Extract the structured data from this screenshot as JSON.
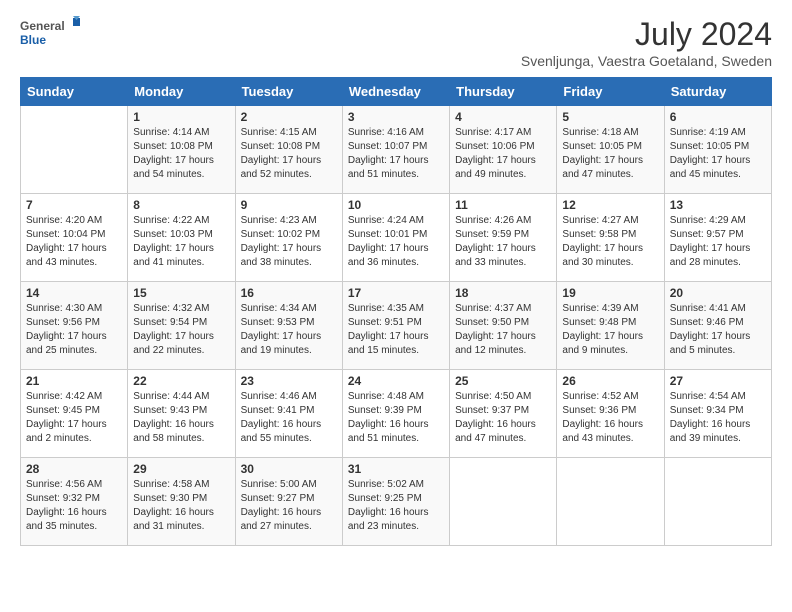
{
  "header": {
    "logo_general": "General",
    "logo_blue": "Blue",
    "title": "July 2024",
    "location": "Svenljunga, Vaestra Goetaland, Sweden"
  },
  "calendar": {
    "days_of_week": [
      "Sunday",
      "Monday",
      "Tuesday",
      "Wednesday",
      "Thursday",
      "Friday",
      "Saturday"
    ],
    "weeks": [
      [
        {
          "day": "",
          "info": ""
        },
        {
          "day": "1",
          "info": "Sunrise: 4:14 AM\nSunset: 10:08 PM\nDaylight: 17 hours\nand 54 minutes."
        },
        {
          "day": "2",
          "info": "Sunrise: 4:15 AM\nSunset: 10:08 PM\nDaylight: 17 hours\nand 52 minutes."
        },
        {
          "day": "3",
          "info": "Sunrise: 4:16 AM\nSunset: 10:07 PM\nDaylight: 17 hours\nand 51 minutes."
        },
        {
          "day": "4",
          "info": "Sunrise: 4:17 AM\nSunset: 10:06 PM\nDaylight: 17 hours\nand 49 minutes."
        },
        {
          "day": "5",
          "info": "Sunrise: 4:18 AM\nSunset: 10:05 PM\nDaylight: 17 hours\nand 47 minutes."
        },
        {
          "day": "6",
          "info": "Sunrise: 4:19 AM\nSunset: 10:05 PM\nDaylight: 17 hours\nand 45 minutes."
        }
      ],
      [
        {
          "day": "7",
          "info": "Sunrise: 4:20 AM\nSunset: 10:04 PM\nDaylight: 17 hours\nand 43 minutes."
        },
        {
          "day": "8",
          "info": "Sunrise: 4:22 AM\nSunset: 10:03 PM\nDaylight: 17 hours\nand 41 minutes."
        },
        {
          "day": "9",
          "info": "Sunrise: 4:23 AM\nSunset: 10:02 PM\nDaylight: 17 hours\nand 38 minutes."
        },
        {
          "day": "10",
          "info": "Sunrise: 4:24 AM\nSunset: 10:01 PM\nDaylight: 17 hours\nand 36 minutes."
        },
        {
          "day": "11",
          "info": "Sunrise: 4:26 AM\nSunset: 9:59 PM\nDaylight: 17 hours\nand 33 minutes."
        },
        {
          "day": "12",
          "info": "Sunrise: 4:27 AM\nSunset: 9:58 PM\nDaylight: 17 hours\nand 30 minutes."
        },
        {
          "day": "13",
          "info": "Sunrise: 4:29 AM\nSunset: 9:57 PM\nDaylight: 17 hours\nand 28 minutes."
        }
      ],
      [
        {
          "day": "14",
          "info": "Sunrise: 4:30 AM\nSunset: 9:56 PM\nDaylight: 17 hours\nand 25 minutes."
        },
        {
          "day": "15",
          "info": "Sunrise: 4:32 AM\nSunset: 9:54 PM\nDaylight: 17 hours\nand 22 minutes."
        },
        {
          "day": "16",
          "info": "Sunrise: 4:34 AM\nSunset: 9:53 PM\nDaylight: 17 hours\nand 19 minutes."
        },
        {
          "day": "17",
          "info": "Sunrise: 4:35 AM\nSunset: 9:51 PM\nDaylight: 17 hours\nand 15 minutes."
        },
        {
          "day": "18",
          "info": "Sunrise: 4:37 AM\nSunset: 9:50 PM\nDaylight: 17 hours\nand 12 minutes."
        },
        {
          "day": "19",
          "info": "Sunrise: 4:39 AM\nSunset: 9:48 PM\nDaylight: 17 hours\nand 9 minutes."
        },
        {
          "day": "20",
          "info": "Sunrise: 4:41 AM\nSunset: 9:46 PM\nDaylight: 17 hours\nand 5 minutes."
        }
      ],
      [
        {
          "day": "21",
          "info": "Sunrise: 4:42 AM\nSunset: 9:45 PM\nDaylight: 17 hours\nand 2 minutes."
        },
        {
          "day": "22",
          "info": "Sunrise: 4:44 AM\nSunset: 9:43 PM\nDaylight: 16 hours\nand 58 minutes."
        },
        {
          "day": "23",
          "info": "Sunrise: 4:46 AM\nSunset: 9:41 PM\nDaylight: 16 hours\nand 55 minutes."
        },
        {
          "day": "24",
          "info": "Sunrise: 4:48 AM\nSunset: 9:39 PM\nDaylight: 16 hours\nand 51 minutes."
        },
        {
          "day": "25",
          "info": "Sunrise: 4:50 AM\nSunset: 9:37 PM\nDaylight: 16 hours\nand 47 minutes."
        },
        {
          "day": "26",
          "info": "Sunrise: 4:52 AM\nSunset: 9:36 PM\nDaylight: 16 hours\nand 43 minutes."
        },
        {
          "day": "27",
          "info": "Sunrise: 4:54 AM\nSunset: 9:34 PM\nDaylight: 16 hours\nand 39 minutes."
        }
      ],
      [
        {
          "day": "28",
          "info": "Sunrise: 4:56 AM\nSunset: 9:32 PM\nDaylight: 16 hours\nand 35 minutes."
        },
        {
          "day": "29",
          "info": "Sunrise: 4:58 AM\nSunset: 9:30 PM\nDaylight: 16 hours\nand 31 minutes."
        },
        {
          "day": "30",
          "info": "Sunrise: 5:00 AM\nSunset: 9:27 PM\nDaylight: 16 hours\nand 27 minutes."
        },
        {
          "day": "31",
          "info": "Sunrise: 5:02 AM\nSunset: 9:25 PM\nDaylight: 16 hours\nand 23 minutes."
        },
        {
          "day": "",
          "info": ""
        },
        {
          "day": "",
          "info": ""
        },
        {
          "day": "",
          "info": ""
        }
      ]
    ]
  }
}
